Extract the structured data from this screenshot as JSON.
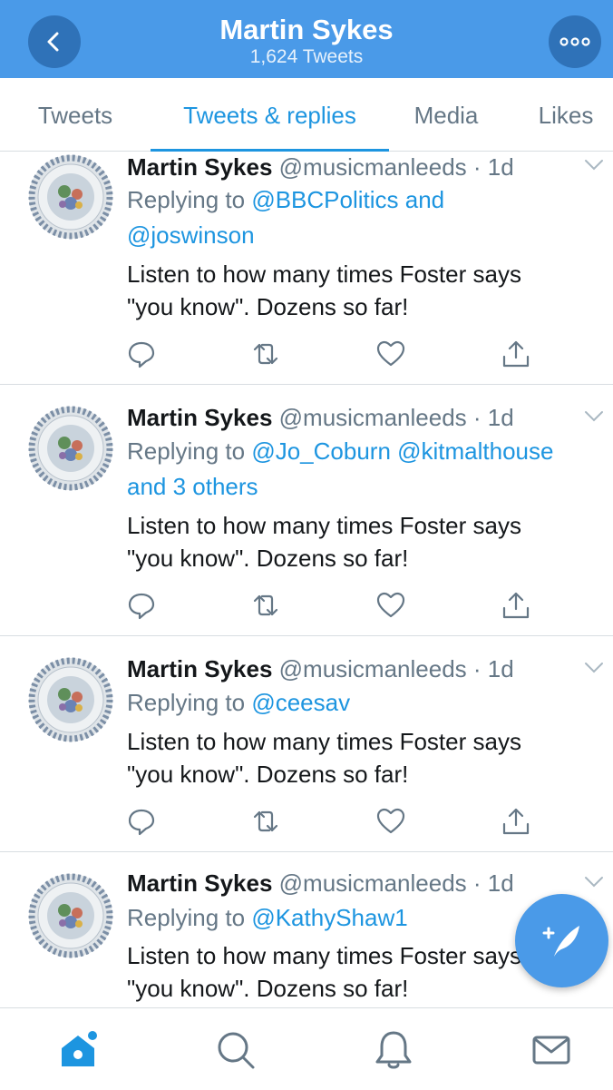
{
  "header": {
    "title": "Martin Sykes",
    "subtitle": "1,624 Tweets",
    "back_icon": "chevron-left-icon",
    "more_icon": "more-horizontal-icon"
  },
  "tabs": [
    {
      "label": "Tweets",
      "active": false
    },
    {
      "label": "Tweets & replies",
      "active": true
    },
    {
      "label": "Media",
      "active": false
    },
    {
      "label": "Likes",
      "active": false
    }
  ],
  "tweets": [
    {
      "name": "Martin Sykes",
      "handle": "@musicmanleeds",
      "time": "· 1d",
      "reply_prefix": "Replying to ",
      "reply_line1": "@BBCPolitics and",
      "reply_line2": "@joswinson",
      "text_line1": "Listen to how many times Foster says",
      "text_line2": "\"you know\". Dozens so far!"
    },
    {
      "name": "Martin Sykes",
      "handle": "@musicmanleeds",
      "time": "· 1d",
      "reply_prefix": "Replying to ",
      "reply_line1": "@Jo_Coburn @kitmalthouse",
      "reply_line2": "and 3 others",
      "text_line1": "Listen to how many times Foster says",
      "text_line2": "\"you know\". Dozens so far!"
    },
    {
      "name": "Martin Sykes",
      "handle": "@musicmanleeds",
      "time": "· 1d",
      "reply_prefix": "Replying to ",
      "reply_line1": "@ceesav",
      "text_line1": "Listen to how many times Foster says",
      "text_line2": "\"you know\". Dozens so far!"
    },
    {
      "name": "Martin Sykes",
      "handle": "@musicmanleeds",
      "time": "· 1d",
      "reply_prefix": "Replying to ",
      "reply_line1": "@KathyShaw1",
      "text_line1": "Listen to how many times Foster says",
      "text_line2": "\"you know\". Dozens so far!"
    }
  ],
  "action_icons": [
    "reply-icon",
    "retweet-icon",
    "like-icon",
    "share-icon"
  ],
  "fab_icon": "compose-tweet-icon",
  "bottom_nav": [
    {
      "icon": "home-icon",
      "active": true
    },
    {
      "icon": "search-icon",
      "active": false
    },
    {
      "icon": "notifications-icon",
      "active": false
    },
    {
      "icon": "messages-icon",
      "active": false
    }
  ],
  "colors": {
    "brand_blue": "#4a9ae8",
    "link_blue": "#1d95e0",
    "secondary_gray": "#657786",
    "text_dark": "#14171a",
    "divider": "#d8dde1"
  }
}
